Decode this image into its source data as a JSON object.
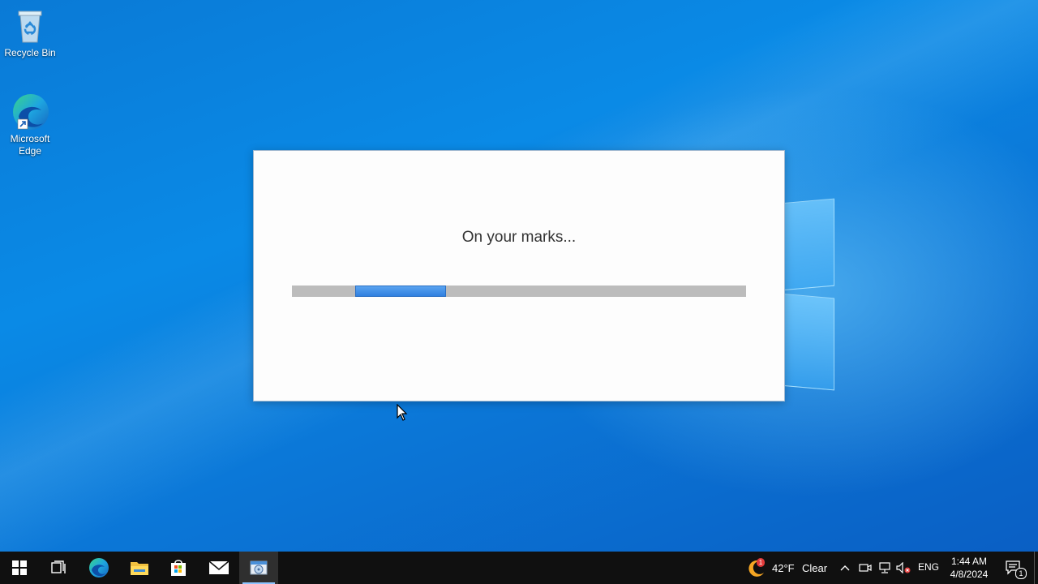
{
  "desktop": {
    "icons": [
      {
        "label": "Recycle Bin"
      },
      {
        "label": "Microsoft Edge"
      }
    ]
  },
  "dialog": {
    "message": "On your marks...",
    "progress": {
      "start_fraction": 0.14,
      "end_fraction": 0.34,
      "fill_color": "#3a8ae6"
    }
  },
  "taskbar": {
    "apps": [
      "start-icon",
      "task-view-icon",
      "edge-icon",
      "file-explorer-icon",
      "store-icon",
      "mail-icon",
      "setup-app-icon"
    ],
    "weather": {
      "temperature": "42°F",
      "condition": "Clear",
      "badge": "1"
    },
    "language": "ENG",
    "time": "1:44 AM",
    "date": "4/8/2024",
    "notification_count": "1"
  },
  "colors": {
    "taskbar_bg": "#101010",
    "desktop_accent": "#0a7ad6"
  }
}
